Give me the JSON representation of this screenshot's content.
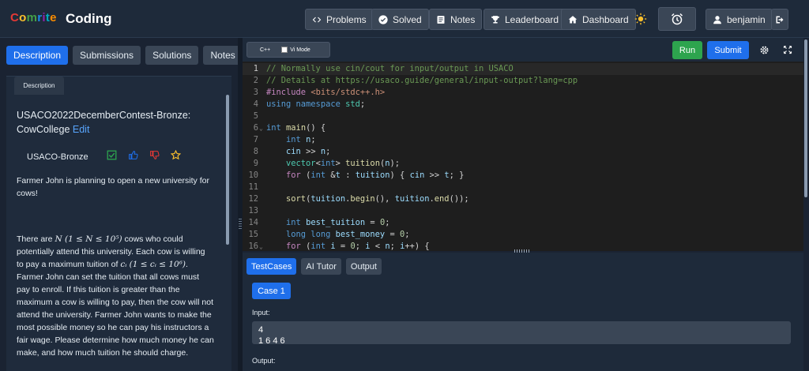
{
  "header": {
    "logo_text": "Comrite",
    "title": "Coding",
    "nav": [
      {
        "label": "Problems",
        "icon": "code-icon"
      },
      {
        "label": "Solved",
        "icon": "check-circle-icon"
      },
      {
        "label": "Notes",
        "icon": "note-icon"
      },
      {
        "label": "Leaderboard",
        "icon": "trophy-icon"
      },
      {
        "label": "Dashboard",
        "icon": "home-icon"
      }
    ],
    "username": "benjamin"
  },
  "left_tabs": [
    "Description",
    "Submissions",
    "Solutions",
    "Notes"
  ],
  "problem": {
    "subtab": "Description",
    "title": "USACO2022DecemberContest-Bronze: CowCollege",
    "edit_label": "Edit",
    "difficulty": "USACO-Bronze",
    "para1": "Farmer John is planning to open a new university for cows!",
    "para2_a": "There are",
    "para2_math1": "N (1 ≤ N ≤ 10⁵)",
    "para2_b": "cows who could potentially attend this university. Each cow is willing to pay a maximum tuition of",
    "para2_math2": "cᵢ (1 ≤ cᵢ ≤ 10⁶)",
    "para2_c": ". Farmer John can set the tuition that all cows must pay to enroll. If this tuition is greater than the maximum a cow is willing to pay, then the cow will not attend the university. Farmer John wants to make the most possible money so he can pay his instructors a fair wage. Please determine how much money he can make, and how much tuition he should charge."
  },
  "editor": {
    "language": "C++",
    "vi_mode_label": "Vi Mode",
    "run_label": "Run",
    "submit_label": "Submit"
  },
  "bottom_tabs": [
    "TestCases",
    "AI Tutor",
    "Output"
  ],
  "testcase": {
    "case_label": "Case 1",
    "input_label": "Input:",
    "input_value": "4\n1 6 4 6",
    "output_label": "Output:"
  },
  "colors": {
    "accent": "#1f6feb",
    "run": "#2da44e"
  }
}
